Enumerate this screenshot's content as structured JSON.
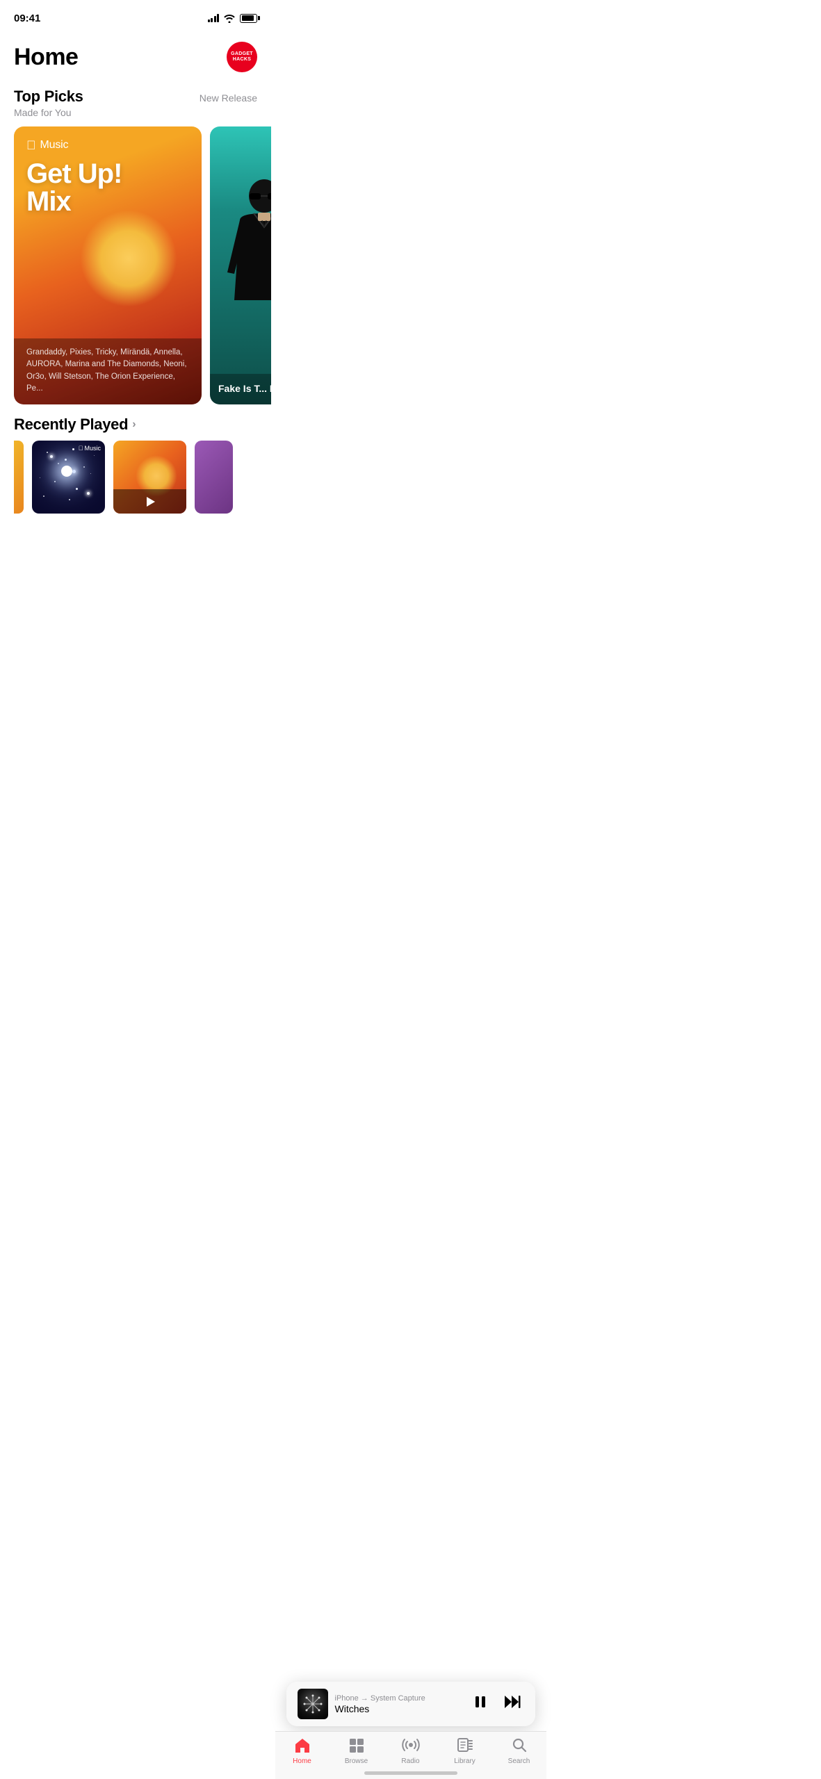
{
  "statusBar": {
    "time": "09:41"
  },
  "header": {
    "title": "Home",
    "badge": {
      "line1": "GADGET",
      "line2": "HACKS"
    }
  },
  "topPicks": {
    "sectionTitle": "Top Picks",
    "subtitleLeft": "Made for You",
    "subtitleRight": "New Release",
    "mainCard": {
      "appleMusicLabel": "Music",
      "titleLine1": "Get Up!",
      "titleLine2": "Mix",
      "footerText": "Grandaddy, Pixies, Tricky, Mïrändä, Annella, AURORA, Marina and The Diamonds, Neoni, Or3o, Will Stetson, The Orion Experience, Pe..."
    },
    "secondCard": {
      "label": "Fake Is T... H..."
    }
  },
  "recentlyPlayed": {
    "title": "Recently Played",
    "items": [
      {
        "type": "stars",
        "appleMusic": true
      },
      {
        "type": "orange-mix"
      },
      {
        "type": "purple"
      }
    ]
  },
  "miniPlayer": {
    "route": "iPhone → System Capture",
    "trackTitle": "Witches"
  },
  "tabBar": {
    "items": [
      {
        "id": "home",
        "label": "Home",
        "icon": "home",
        "active": true
      },
      {
        "id": "browse",
        "label": "Browse",
        "icon": "browse",
        "active": false
      },
      {
        "id": "radio",
        "label": "Radio",
        "icon": "radio",
        "active": false
      },
      {
        "id": "library",
        "label": "Library",
        "icon": "library",
        "active": false
      },
      {
        "id": "search",
        "label": "Search",
        "icon": "search",
        "active": false
      }
    ]
  }
}
